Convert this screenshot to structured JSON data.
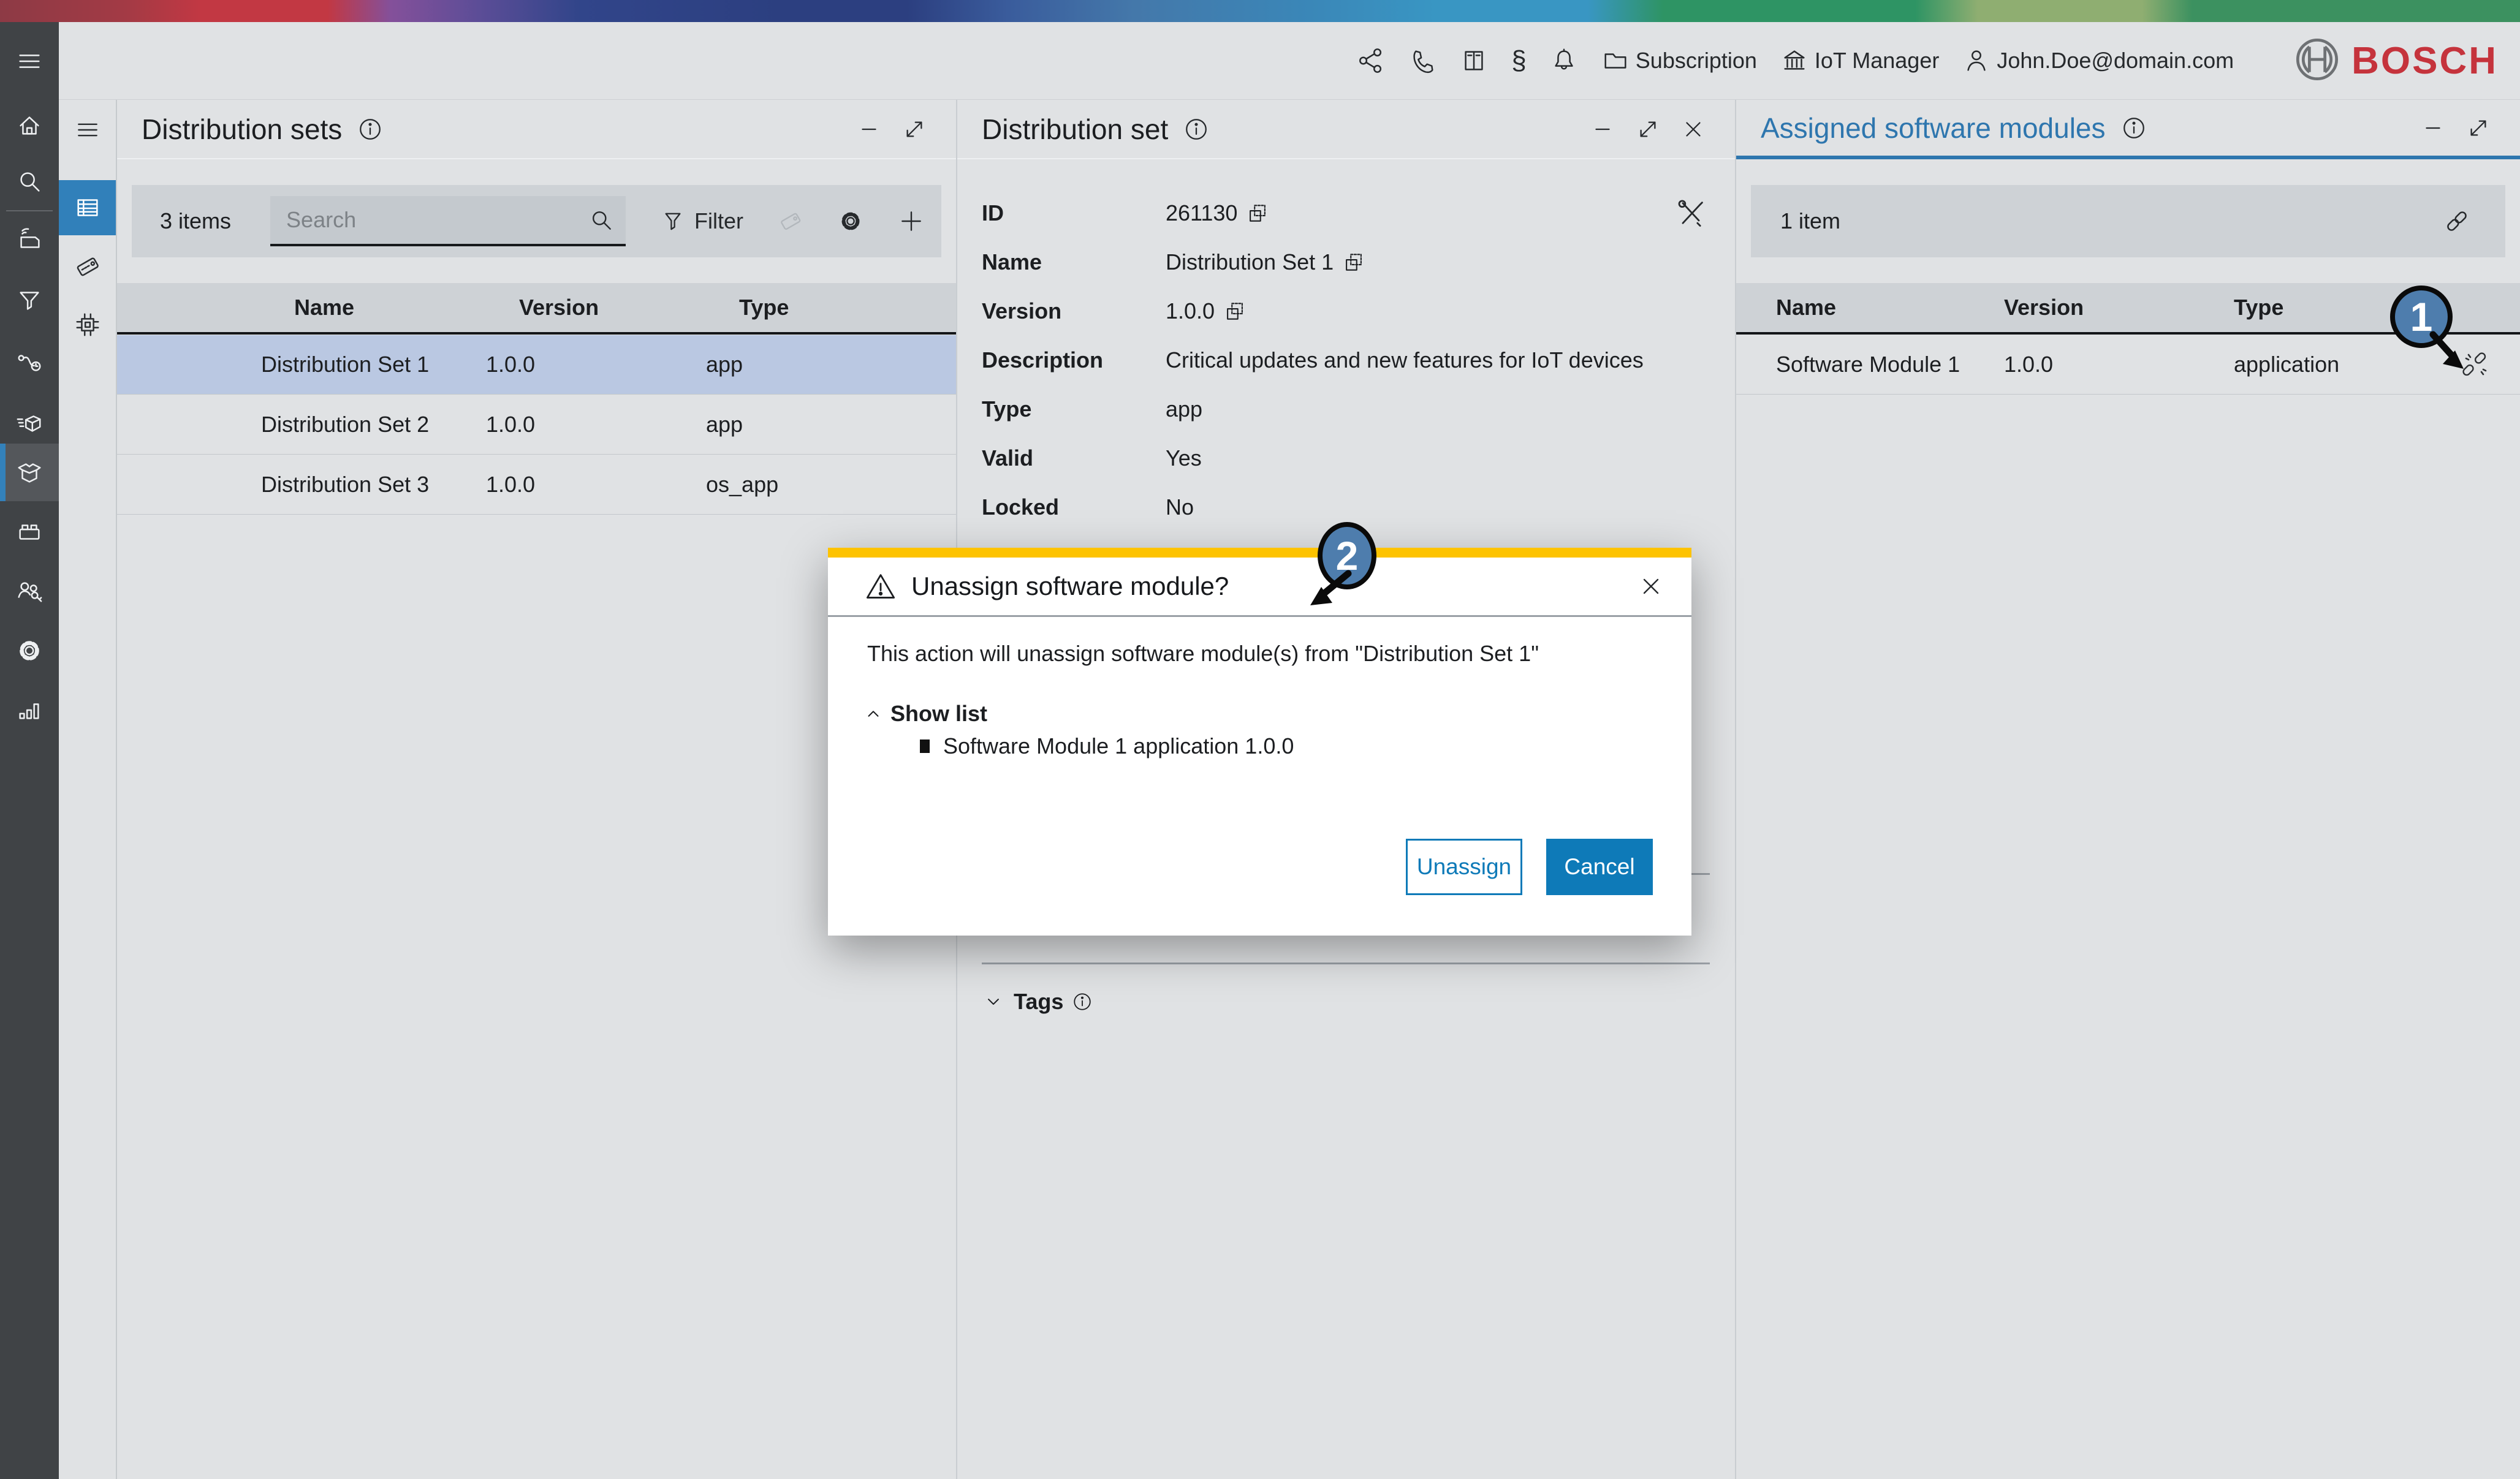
{
  "topbar": {
    "subscription_label": "Subscription",
    "manager_label": "IoT Manager",
    "user_email": "John.Doe@domain.com",
    "brand": "BOSCH"
  },
  "distribution_sets": {
    "title": "Distribution sets",
    "items_count": "3 items",
    "search_placeholder": "Search",
    "filter_label": "Filter",
    "columns": {
      "name": "Name",
      "version": "Version",
      "type": "Type"
    },
    "rows": [
      {
        "name": "Distribution Set 1",
        "version": "1.0.0",
        "type": "app"
      },
      {
        "name": "Distribution Set 2",
        "version": "1.0.0",
        "type": "app"
      },
      {
        "name": "Distribution Set 3",
        "version": "1.0.0",
        "type": "os_app"
      }
    ]
  },
  "distribution_set": {
    "title": "Distribution set",
    "fields": [
      {
        "label": "ID",
        "value": "261130"
      },
      {
        "label": "Name",
        "value": "Distribution Set 1"
      },
      {
        "label": "Version",
        "value": "1.0.0"
      },
      {
        "label": "Description",
        "value": "Critical updates and new features for IoT devices"
      },
      {
        "label": "Type",
        "value": "app"
      },
      {
        "label": "Valid",
        "value": "Yes"
      },
      {
        "label": "Locked",
        "value": "No"
      }
    ],
    "tags_label": "Tags"
  },
  "assigned_modules": {
    "title": "Assigned software modules",
    "items_count": "1 item",
    "columns": {
      "name": "Name",
      "version": "Version",
      "type": "Type"
    },
    "rows": [
      {
        "name": "Software Module 1",
        "version": "1.0.0",
        "type": "application"
      }
    ]
  },
  "modal": {
    "title": "Unassign software module?",
    "message": "This action will unassign software module(s) from \"Distribution Set 1\"",
    "show_list_label": "Show list",
    "list_items": [
      "Software Module 1 application 1.0.0"
    ],
    "unassign_label": "Unassign",
    "cancel_label": "Cancel"
  },
  "annotations": {
    "step1": "1",
    "step2": "2"
  },
  "icons": {
    "topbar": [
      "share-icon",
      "phone-icon",
      "book-icon",
      "section-sign-icon",
      "bell-icon",
      "folder-icon",
      "bank-icon",
      "person-icon",
      "bosch-logo"
    ],
    "sidebar": [
      "menu-icon",
      "home-icon",
      "search-icon",
      "device-icon",
      "funnel-icon",
      "route-icon",
      "package-out-icon",
      "open-box-icon",
      "brick-icon",
      "users-key-icon",
      "gear-icon",
      "bar-chart-icon"
    ],
    "sidebar_secondary": [
      "menu-icon",
      "table-icon",
      "tag-icon",
      "chip-icon"
    ],
    "panel": [
      "info-icon",
      "minimize-icon",
      "expand-icon",
      "close-icon",
      "copy-icon",
      "tools-icon",
      "link-icon",
      "unlink-icon",
      "chevron-up-icon",
      "chevron-down-icon",
      "warning-icon",
      "plus-icon"
    ]
  },
  "colors": {
    "accent_blue": "#2e76ae",
    "button_blue": "#0e7ab8",
    "bosch_red": "#c5333c",
    "modal_yellow": "#fdc300",
    "selected_row": "#bac8e2",
    "sidebar_dark": "#404346"
  }
}
